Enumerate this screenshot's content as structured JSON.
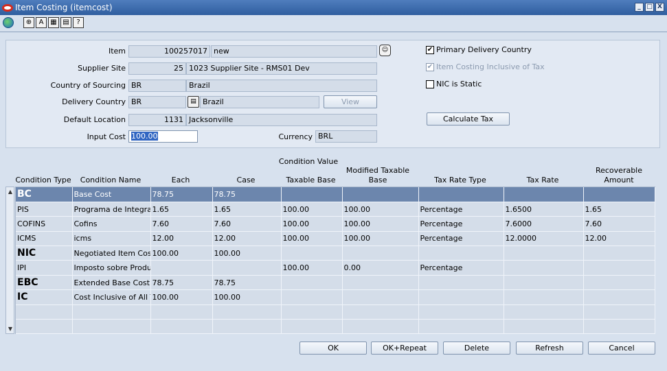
{
  "window": {
    "title": "Item Costing (itemcost)",
    "buttons": [
      "_",
      "□",
      "X"
    ]
  },
  "toolbar": {
    "icons": [
      "globe-icon",
      "help-icon",
      "spell-icon",
      "calc-icon",
      "print-icon",
      "question-icon"
    ]
  },
  "form": {
    "item_label": "Item",
    "item_value": "100257017",
    "item_desc": "new",
    "supplier_site_label": "Supplier Site",
    "supplier_site_value": "25",
    "supplier_site_desc": "1023 Supplier Site - RMS01 Dev",
    "country_sourcing_label": "Country of Sourcing",
    "country_sourcing_value": "BR",
    "country_sourcing_desc": "Brazil",
    "delivery_country_label": "Delivery Country",
    "delivery_country_value": "BR",
    "delivery_country_desc": "Brazil",
    "view_button": "View",
    "default_location_label": "Default Location",
    "default_location_value": "1131",
    "default_location_desc": "Jacksonville",
    "input_cost_label": "Input Cost",
    "input_cost_value": "100.00",
    "currency_label": "Currency",
    "currency_value": "BRL",
    "primary_delivery_country": {
      "label": "Primary Delivery Country",
      "checked": "✔"
    },
    "item_costing_inclusive": {
      "label": "Item Costing Inclusive of Tax",
      "checked": "✔"
    },
    "nic_static": {
      "label": "NIC is Static",
      "checked": ""
    },
    "calculate_tax_button": "Calculate Tax"
  },
  "grid": {
    "group_header": "Condition Value",
    "columns": [
      "Condition Type",
      "Condition Name",
      "Each",
      "Case",
      "Taxable Base",
      "Modified Taxable Base",
      "Tax Rate Type",
      "Tax Rate",
      "Recoverable Amount"
    ],
    "rows": [
      [
        "BC",
        "Base Cost",
        "78.75",
        "78.75",
        "",
        "",
        "",
        "",
        ""
      ],
      [
        "PIS",
        "Programa de Integra??",
        "1.65",
        "1.65",
        "100.00",
        "100.00",
        "Percentage",
        "1.6500",
        "1.65"
      ],
      [
        "COFINS",
        "Cofins",
        "7.60",
        "7.60",
        "100.00",
        "100.00",
        "Percentage",
        "7.6000",
        "7.60"
      ],
      [
        "ICMS",
        "icms",
        "12.00",
        "12.00",
        "100.00",
        "100.00",
        "Percentage",
        "12.0000",
        "12.00"
      ],
      [
        "NIC",
        "Negotiated Item Cost",
        "100.00",
        "100.00",
        "",
        "",
        "",
        "",
        ""
      ],
      [
        "IPI",
        "Imposto sobre Produtos",
        "",
        "",
        "100.00",
        "0.00",
        "Percentage",
        "",
        ""
      ],
      [
        "EBC",
        "Extended Base Cost",
        "78.75",
        "78.75",
        "",
        "",
        "",
        "",
        ""
      ],
      [
        "IC",
        "Cost Inclusive of All Ta",
        "100.00",
        "100.00",
        "",
        "",
        "",
        "",
        ""
      ],
      [
        "",
        "",
        "",
        "",
        "",
        "",
        "",
        "",
        ""
      ],
      [
        "",
        "",
        "",
        "",
        "",
        "",
        "",
        "",
        ""
      ]
    ]
  },
  "actions": {
    "ok": "OK",
    "ok_repeat": "OK+Repeat",
    "delete": "Delete",
    "refresh": "Refresh",
    "cancel": "Cancel"
  }
}
